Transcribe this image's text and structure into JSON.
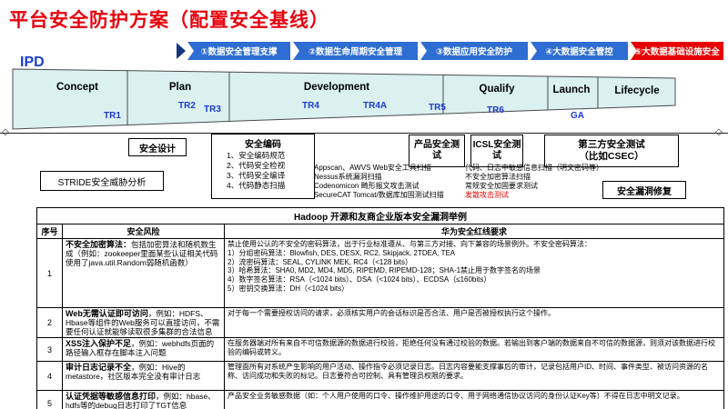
{
  "title": "平台安全防护方案（配置安全基线）",
  "colors": {
    "title_red": "#e8000d",
    "badge_blue": "#2e6dd2",
    "badge_red": "#e60000",
    "funnel_fill": "#daf1f0",
    "milestone_blue": "#1c39d2",
    "highlight_red": "#e60000"
  },
  "icons": {
    "diamond": "◇"
  },
  "badges": [
    {
      "label": "①数据安全管理支撑"
    },
    {
      "label": "②数据生命周期安全管理"
    },
    {
      "label": "③数据应用安全防护"
    },
    {
      "label": "④大数据安全管控"
    },
    {
      "label": "⑤大数据基础设施安全"
    }
  ],
  "ipd_label": "IPD",
  "funnel": {
    "phases": [
      "Concept",
      "Plan",
      "Development",
      "Qualify",
      "Launch",
      "Lifecycle"
    ],
    "milestones": [
      "TR1",
      "TR2",
      "TR3",
      "TR4",
      "TR4A",
      "TR5",
      "TR6",
      "GA"
    ]
  },
  "boxes": {
    "security_design": "安全设计",
    "secure_coding": {
      "title": "安全编码",
      "items": [
        "1、安全编码规范",
        "2、代码安全检视",
        "3、代码安全编译",
        "4、代码静态扫描"
      ]
    },
    "product_test": "产品安全测试",
    "icsl_test": "ICSL安全测试",
    "third_party_test": "第三方安全测试\n（比如CSEC）",
    "stride": "STRIDE安全威胁分析",
    "vuln_fix": "安全漏洞修复"
  },
  "tool_scans": [
    "Appscan、AWVS Web安全工具扫描",
    "Nessus系统漏洞扫描",
    "Codenomicon 畸形报文攻击测试",
    "SecureCAT Tomcat/数据库加固测试扫描"
  ],
  "sensitive_scans": {
    "items": [
      "代码、日志中敏感信息扫描（明文密码等）",
      "不安全加密算法扫描",
      "常规安全加固要求测试"
    ],
    "highlight": "发散攻击测试"
  },
  "table": {
    "title": "Hadoop 开源和友商企业版本安全漏洞举例",
    "headers": [
      "序号",
      "安全风险",
      "华为安全红线要求"
    ],
    "rows": [
      {
        "num": "1",
        "term": "不安全加密算法：",
        "desc": "包括加密算法和随机数生成（例如：zookeeper里面某些认证相关代码使用了java.util.Random弱随机函数）",
        "req": "禁止使用公认的不安全的密码算法，出于行业标准遵从、与第三方对接、向下兼容的场景例外。不安全密码算法：\n1）分组密码算法：Blowfish, DES, DESX, RC2, Skipjack, 2TDEA, TEA\n2）流密码算法：SEAL, CYLINK MEK, RC4（<128 bits）\n3）哈希算法：SHA0, MD2, MD4, MD5, RIPEMD, RIPEMD-128；SHA-1禁止用于数字签名的场景\n4）数字签名算法：RSA（<1024 bits）、DSA（<1024 bits）、ECDSA（≤160bits）\n5）密钥交换算法：DH（<1024 bits）"
      },
      {
        "num": "2",
        "term": "Web无需认证即可访问",
        "desc": "，例如：HDFS、Hbase等组件的Web服务可以直接访问，不需要任何认证就能够读取很多集群的合法信息",
        "req": "对于每一个需要授权访问的请求，必须核实用户的会话标识是否合法、用户是否被授权执行这个操作。"
      },
      {
        "num": "3",
        "term": "XSS注入保护不足",
        "desc": "，例如：webhdfs页面的路径输入框存在脚本注入问题",
        "req": "在服务器端对所有来自不可信数据源的数据进行校验，拒绝任何没有通过校验的数据。若输出到客户端的数据来自不可信的数据源，则须对该数据进行校验的编码或转义。"
      },
      {
        "num": "4",
        "term": "审计日志记录不全",
        "desc": "，例如：Hive的metastore，社区版本完全没有审计日志",
        "req": "管理面所有对系统产生影响的用户活动、操作指令必须记录日志。日志内容要能支撑事后的审计，记录包括用户ID、时间、事件类型、被访问资源的名称、访问成功和失败的标记。日志要符合可控制、具有管理员权限的要求。"
      },
      {
        "num": "5",
        "term": "认证凭据等敏感信息打印",
        "desc": "，例如：hbase、hdfs等的debug日志打印了TGT信息",
        "req": "产品安全业务敏感数据（如：个人用户使用的口令、操作维护用途的口令、用于网络通信协议访问的身份认证Key等）不得在日志中明文记录。"
      }
    ]
  }
}
